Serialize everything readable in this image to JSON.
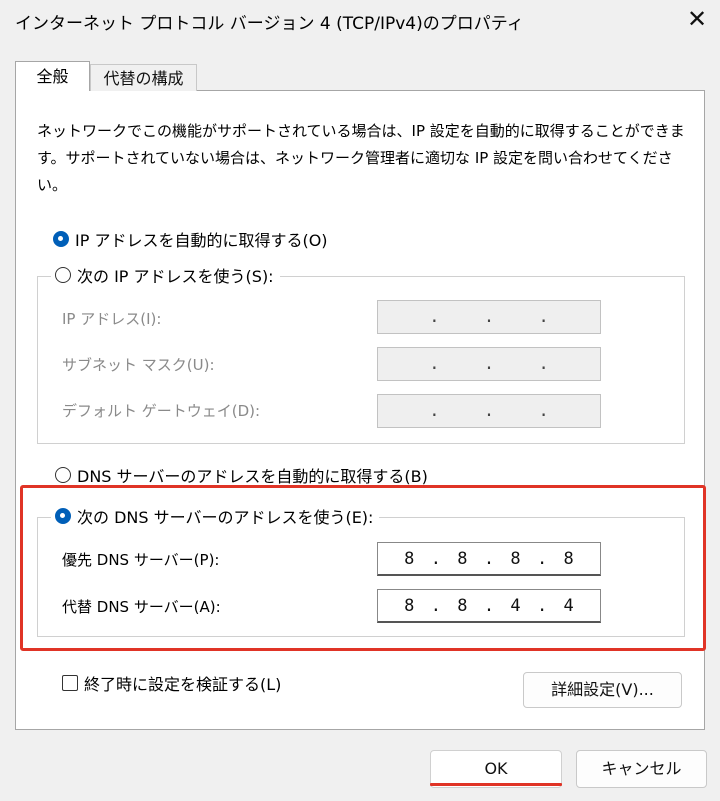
{
  "window": {
    "title": "インターネット プロトコル バージョン 4 (TCP/IPv4)のプロパティ",
    "close_symbol": "✕"
  },
  "tabs": [
    {
      "label": "全般",
      "active": true
    },
    {
      "label": "代替の構成",
      "active": false
    }
  ],
  "description": "ネットワークでこの機能がサポートされている場合は、IP 設定を自動的に取得することができます。サポートされていない場合は、ネットワーク管理者に適切な IP 設定を問い合わせてください。",
  "ip_section": {
    "auto_label": "IP アドレスを自動的に取得する(O)",
    "auto_selected": true,
    "manual_label": "次の IP アドレスを使う(S):",
    "manual_selected": false,
    "fields": [
      {
        "label": "IP アドレス(I):",
        "octets": [
          "",
          "",
          "",
          ""
        ]
      },
      {
        "label": "サブネット マスク(U):",
        "octets": [
          "",
          "",
          "",
          ""
        ]
      },
      {
        "label": "デフォルト ゲートウェイ(D):",
        "octets": [
          "",
          "",
          "",
          ""
        ]
      }
    ]
  },
  "dns_section": {
    "auto_label": "DNS サーバーのアドレスを自動的に取得する(B)",
    "auto_selected": false,
    "manual_label": "次の DNS サーバーのアドレスを使う(E):",
    "manual_selected": true,
    "preferred": {
      "label": "優先 DNS サーバー(P):",
      "octets": [
        "8",
        "8",
        "8",
        "8"
      ]
    },
    "alternate": {
      "label": "代替 DNS サーバー(A):",
      "octets": [
        "8",
        "8",
        "4",
        "4"
      ]
    }
  },
  "validate_checkbox": {
    "label": "終了時に設定を検証する(L)",
    "checked": false
  },
  "buttons": {
    "advanced": "詳細設定(V)...",
    "ok": "OK",
    "cancel": "キャンセル"
  },
  "separator": ".",
  "colors": {
    "accent": "#005fb8",
    "highlight": "#e03426",
    "panel": "#ffffff",
    "window": "#f0f0f0"
  }
}
